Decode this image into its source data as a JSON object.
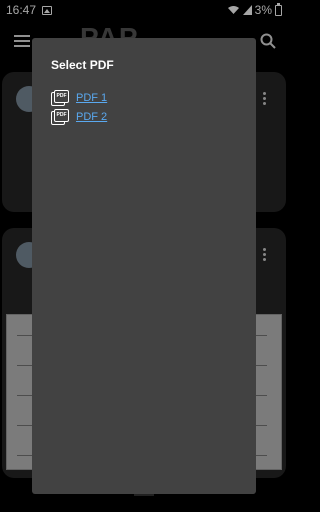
{
  "status_bar": {
    "time": "16:47",
    "battery": "3%"
  },
  "app_bar": {
    "logo_text": "PAP"
  },
  "dialog": {
    "title": "Select PDF",
    "icon_text": "PDF",
    "items": [
      {
        "label": "PDF 1"
      },
      {
        "label": "PDF 2"
      }
    ]
  }
}
